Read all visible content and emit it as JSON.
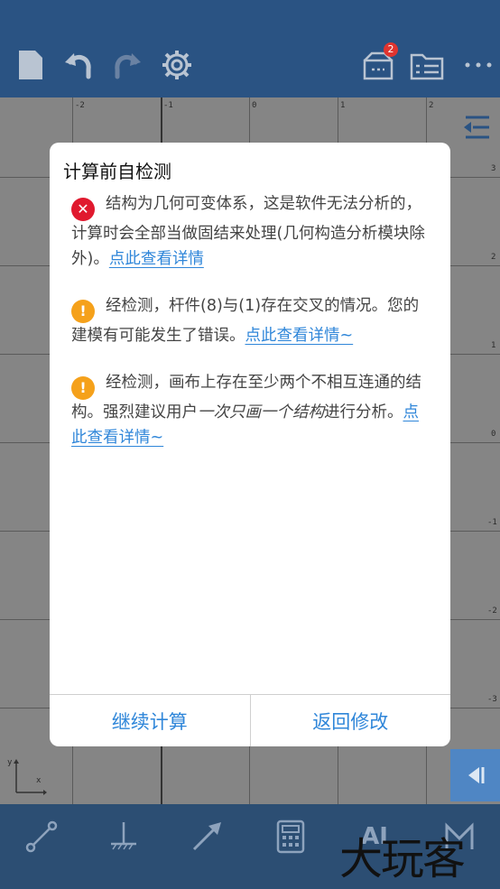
{
  "toolbar": {
    "notification_count": "2",
    "icons": [
      "new-file-icon",
      "undo-icon",
      "redo-icon",
      "settings-icon",
      "inbox-icon",
      "list-panel-icon",
      "more-icon"
    ]
  },
  "grid": {
    "x_ticks": [
      "-2",
      "-1",
      "0",
      "1",
      "2"
    ],
    "y_ticks": [
      "3",
      "2",
      "1",
      "0",
      "-1",
      "-2",
      "-3"
    ],
    "axis_labels": {
      "x": "x",
      "y": "y"
    }
  },
  "dialog": {
    "title": "计算前自检测",
    "messages": [
      {
        "type": "error",
        "text_before": "结构为几何可变体系，这是软件无法分析的，计算时会全部当做固结来处理(几何构造分析模块除外)。",
        "link": "点此查看详情"
      },
      {
        "type": "warning",
        "text_before": "经检测，杆件(8)与(1)存在交叉的情况。您的建模有可能发生了错误。",
        "link": "点此查看详情~"
      },
      {
        "type": "warning",
        "text_before": "经检测，画布上存在至少两个不相互连通的结构。强烈建议用户",
        "emphasis": "一次只画一个结构",
        "text_after": "进行分析。",
        "link": "点此查看详情~"
      }
    ],
    "buttons": {
      "continue": "继续计算",
      "back": "返回修改"
    }
  },
  "bottombar": {
    "icons": [
      "link-tool-icon",
      "support-tool-icon",
      "force-arrow-icon",
      "calculator-icon",
      "ai-icon",
      "moment-icon"
    ],
    "ai_label": "AI"
  },
  "watermark": "大玩客",
  "colors": {
    "topbar": "#2a5383",
    "accent": "#2f86d9",
    "error": "#e0192e",
    "warning": "#f5a11b"
  }
}
